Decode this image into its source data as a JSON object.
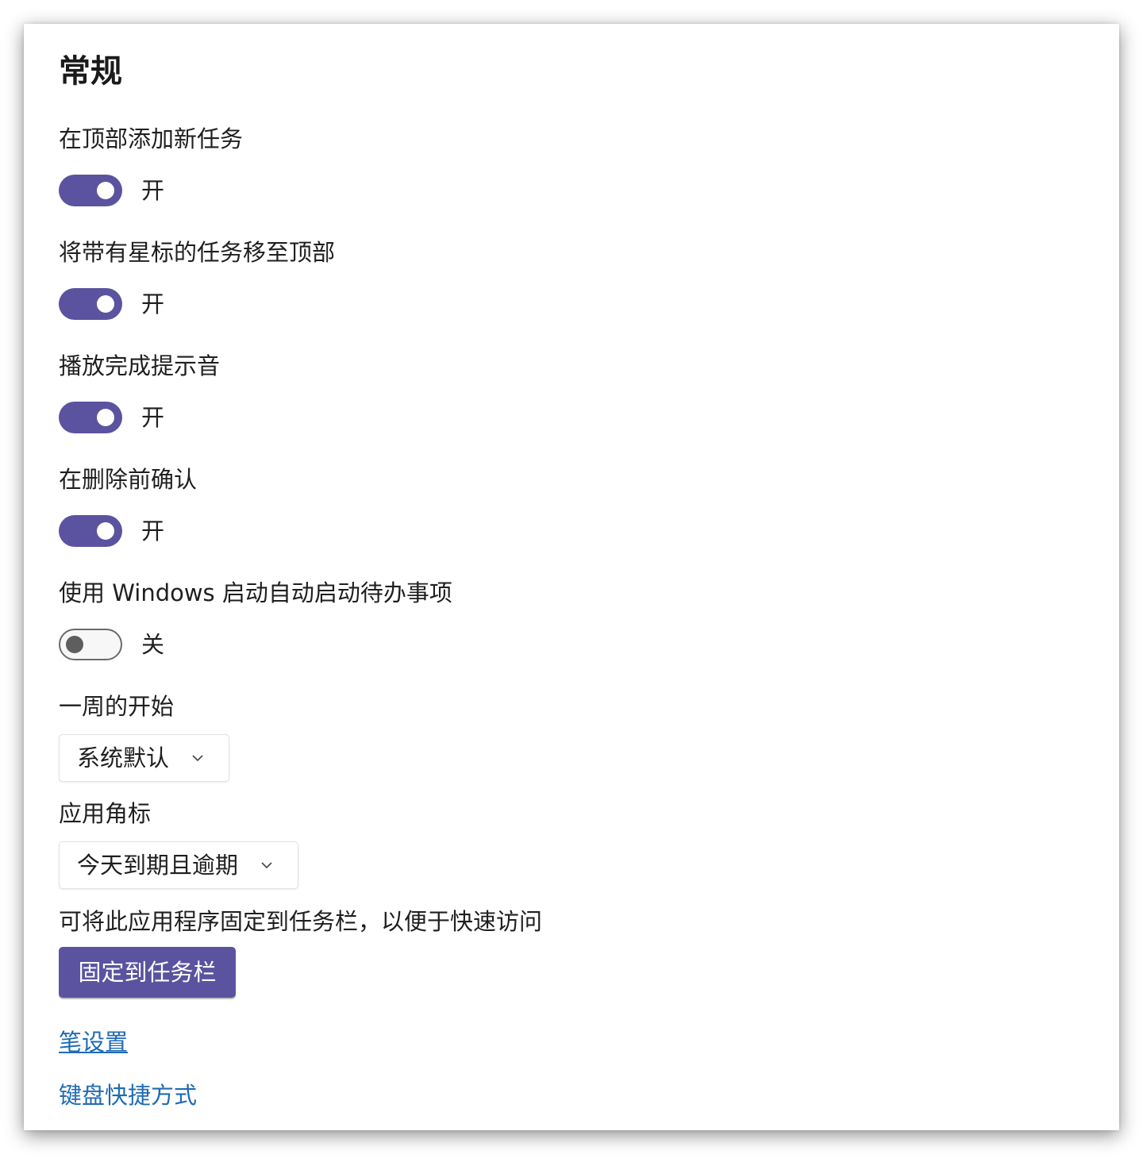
{
  "section": {
    "title": "常规"
  },
  "settings": {
    "add_to_top": {
      "label": "在顶部添加新任务",
      "state": "开",
      "on": true
    },
    "starred_to_top": {
      "label": "将带有星标的任务移至顶部",
      "state": "开",
      "on": true
    },
    "completion_sound": {
      "label": "播放完成提示音",
      "state": "开",
      "on": true
    },
    "confirm_delete": {
      "label": "在删除前确认",
      "state": "开",
      "on": true
    },
    "autostart": {
      "label": "使用 Windows 启动自动启动待办事项",
      "state": "关",
      "on": false
    }
  },
  "week_start": {
    "label": "一周的开始",
    "value": "系统默认"
  },
  "app_badge": {
    "label": "应用角标",
    "value": "今天到期且逾期"
  },
  "pin": {
    "description": "可将此应用程序固定到任务栏，以便于快速访问",
    "button_label": "固定到任务栏"
  },
  "links": {
    "pen_settings": "笔设置",
    "keyboard_shortcuts": "键盘快捷方式"
  },
  "colors": {
    "accent": "#5b539f",
    "link": "#1f6bb5",
    "toggle_off_knob": "#5e5e5e"
  },
  "icons": {
    "dropdown_chevron": "chevron-down-icon"
  }
}
